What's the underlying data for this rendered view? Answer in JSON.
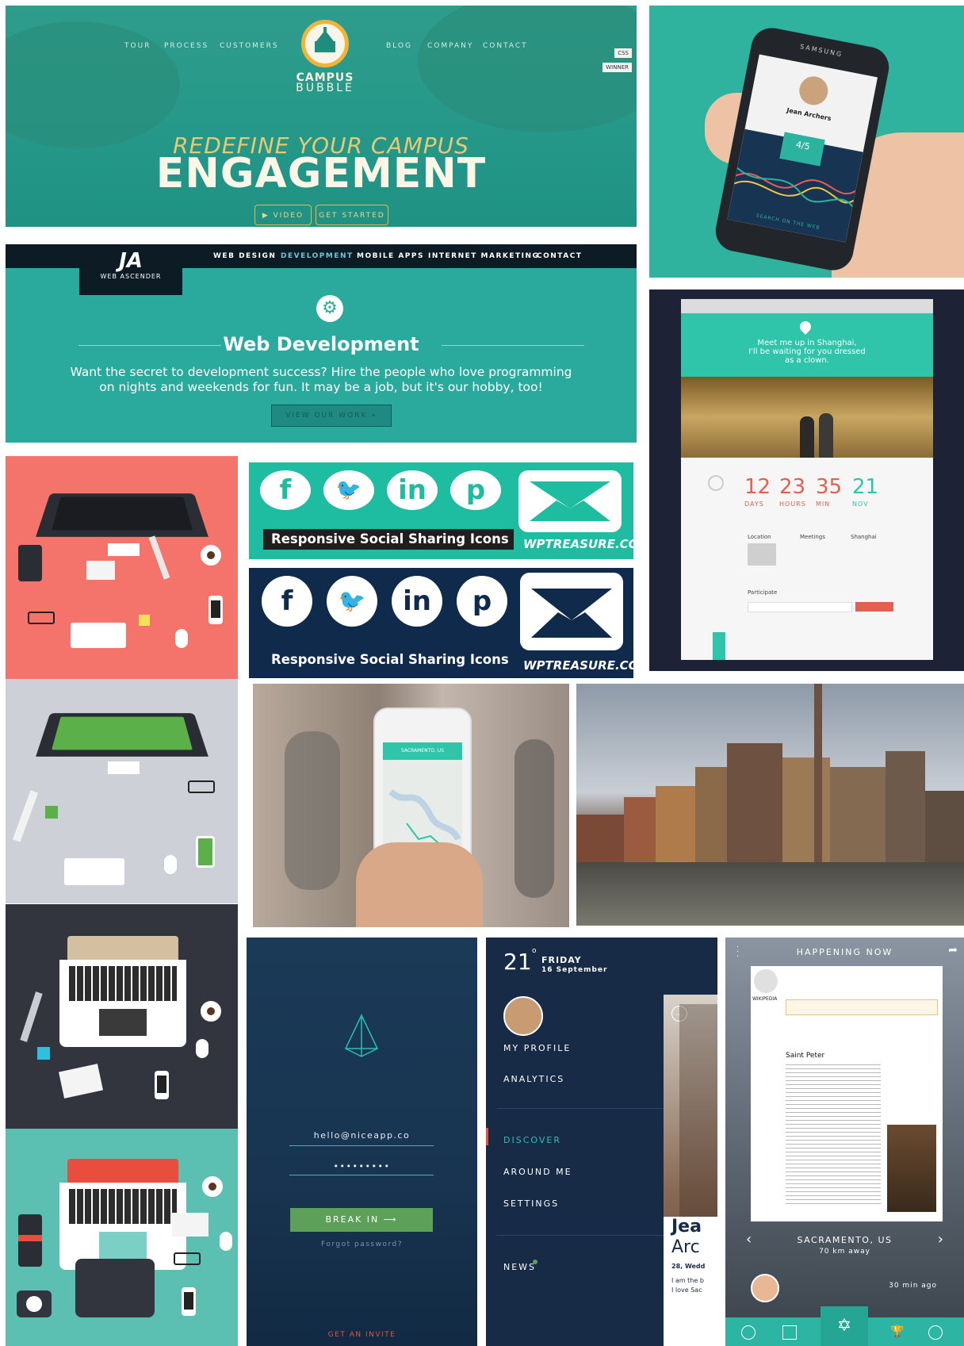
{
  "campus": {
    "nav_left": [
      "TOUR",
      "PROCESS",
      "CUSTOMERS"
    ],
    "nav_right": [
      "BLOG",
      "COMPANY",
      "CONTACT"
    ],
    "logo_line1": "CAMPUS",
    "logo_line2": "BUBBLE",
    "tagline": "REDEFINE YOUR CAMPUS",
    "headline": "ENGAGEMENT",
    "video_btn": "▶ VIDEO",
    "start_btn": "GET STARTED",
    "badge_css": "CSS",
    "badge_winner": "WINNER"
  },
  "phone_app": {
    "brand": "SAMSUNG",
    "profile_name": "Jean Archers",
    "rating": "4/5",
    "cta": "SEARCH ON THE WEB"
  },
  "ascender": {
    "logo_text": "WEB ASCENDER",
    "nav": [
      "WEB DESIGN",
      "DEVELOPMENT",
      "MOBILE APPS",
      "INTERNET MARKETING",
      "CONTACT"
    ],
    "active_color": "#6ec4d8",
    "title": "Web Development",
    "desc_line1": "Want the secret to development success? Hire the people who love programming",
    "desc_line2": "on nights and weekends for fun. It may be a job, but it's our hobby, too!",
    "cta": "VIEW OUR WORK »"
  },
  "social": {
    "icons": [
      "f",
      "in",
      "p"
    ],
    "label": "Responsive Social Sharing Icons",
    "brand": "WPTREASURE.COM",
    "teal": "#1ebca0",
    "navy": "#0f2a4b"
  },
  "event": {
    "hero_line1": "Meet me up in Shanghai,",
    "hero_line2": "I'll be waiting for you dressed",
    "hero_line3": "as a clown.",
    "countdown": [
      {
        "value": "12",
        "label": "DAYS"
      },
      {
        "value": "23",
        "label": "HOURS"
      },
      {
        "value": "35",
        "label": "MIN"
      },
      {
        "value": "21",
        "label": "NOV"
      }
    ],
    "col_location": "Location",
    "col_meetings": "Meetings",
    "col_city": "Shanghai",
    "participate": "Participate"
  },
  "map_phone": {
    "city": "SACRAMENTO, US"
  },
  "login": {
    "email": "hello@niceapp.co",
    "password": "•••••••••",
    "submit": "BREAK IN ⟶",
    "forgot": "Forgot password?",
    "invite": "GET AN INVITE"
  },
  "menu": {
    "day": "21",
    "weekday": "FRIDAY",
    "date": "16 September",
    "items_top": [
      "MY PROFILE",
      "ANALYTICS"
    ],
    "items_mid": [
      "DISCOVER",
      "AROUND ME",
      "SETTINGS"
    ],
    "news": "NEWS",
    "peek_name1": "Jea",
    "peek_name2": "Arc",
    "peek_meta": "28, Wedd",
    "peek_text1": "I am the b",
    "peek_text2": "I love Sac"
  },
  "happening": {
    "header": "HAPPENING NOW",
    "wiki_title": "Saint Peter",
    "wiki_brand": "WIKIPEDIA",
    "location": "SACRAMENTO, US",
    "distance": "70 km away",
    "time": "30 min ago"
  }
}
